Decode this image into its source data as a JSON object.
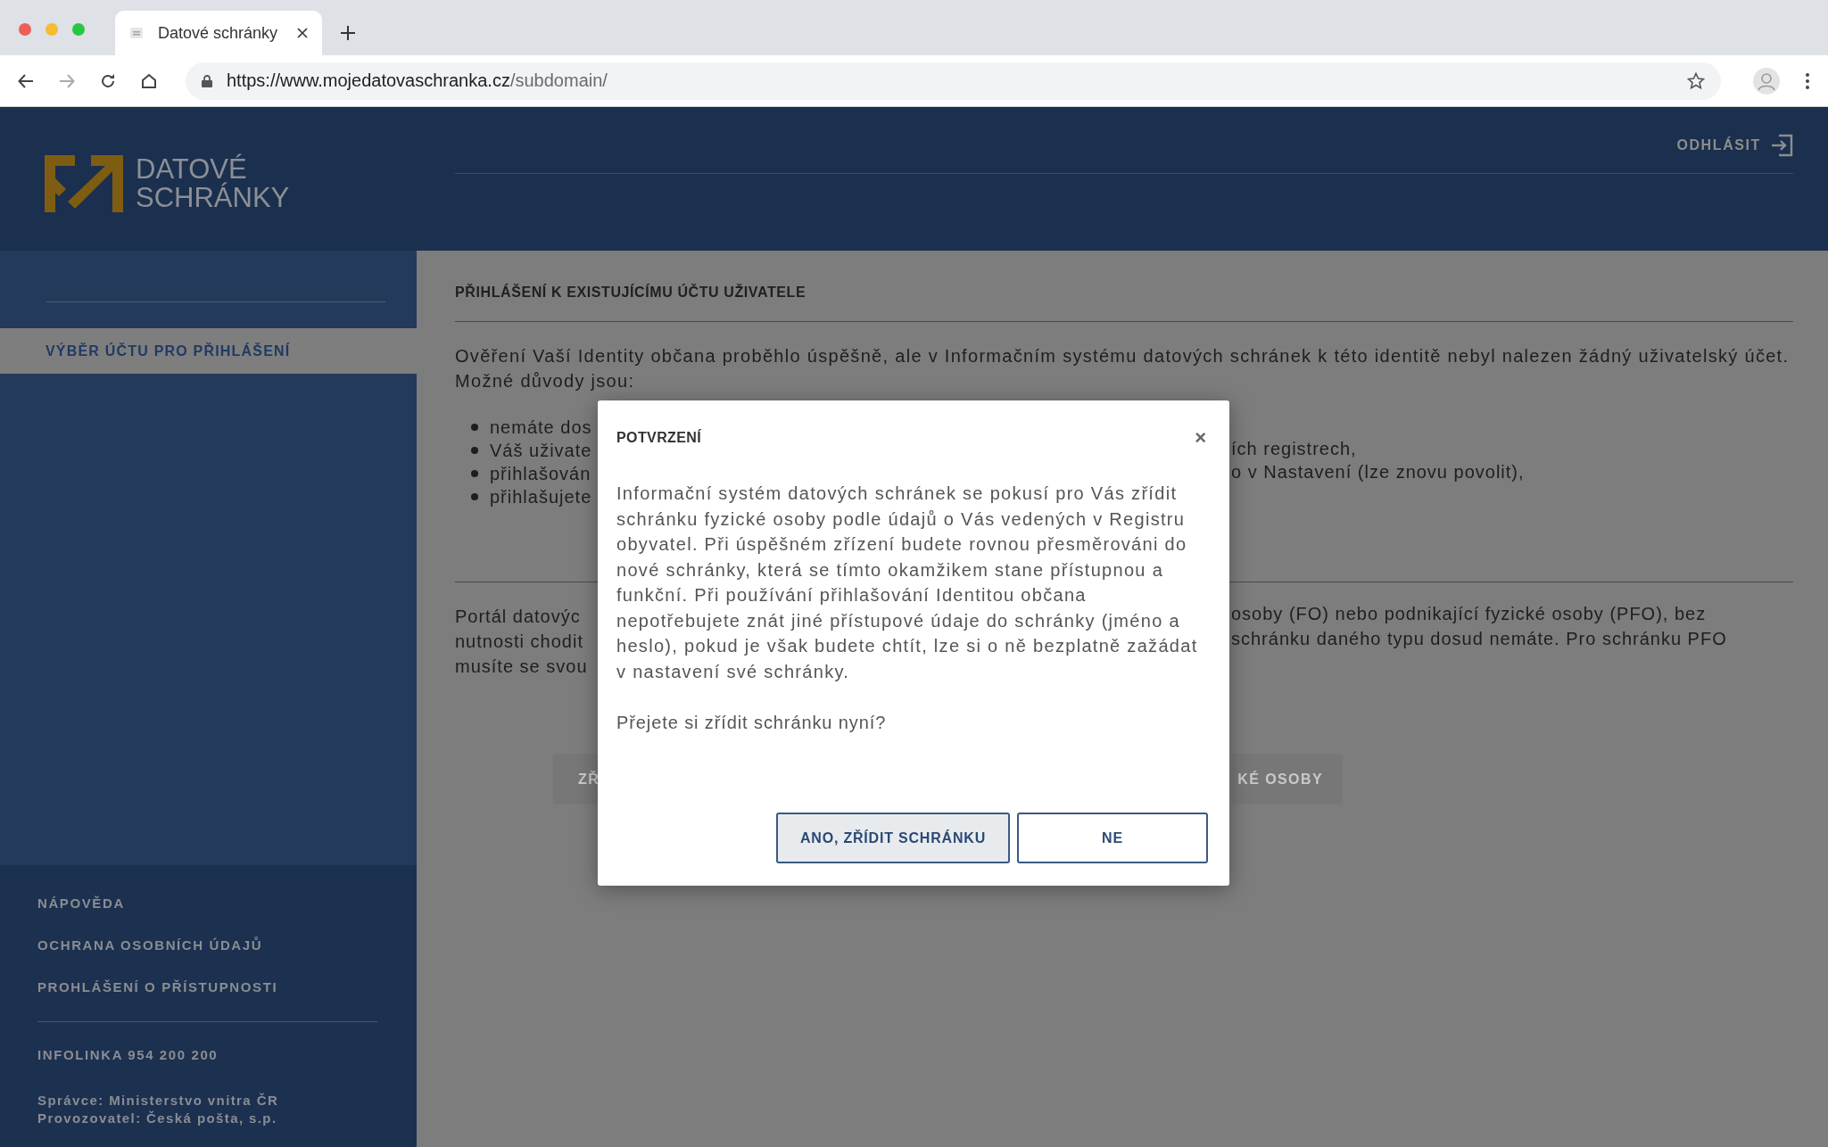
{
  "browser": {
    "tab_title": "Datové schránky",
    "url_host": "https://www.mojedatovaschranka.cz",
    "url_path": "/subdomain/"
  },
  "header": {
    "logo_lines": [
      "DATOVÉ",
      "SCHRÁNKY"
    ],
    "logout": "ODHLÁSIT"
  },
  "sidebar": {
    "items": [
      {
        "label": "VÝBĚR ÚČTU PRO PŘIHLÁŠENÍ",
        "selected": true
      }
    ],
    "footer_links": [
      "NÁPOVĚDA",
      "OCHRANA OSOBNÍCH ÚDAJŮ",
      "PROHLÁŠENÍ O PŘÍSTUPNOSTI"
    ],
    "infoline": "INFOLINKA 954 200 200",
    "operator_lines": [
      "Správce: Ministerstvo vnitra ČR",
      "Provozovatel: Česká pošta, s.p."
    ]
  },
  "main": {
    "heading": "PŘIHLÁŠENÍ K EXISTUJÍCÍMU ÚČTU UŽIVATELE",
    "intro": "Ověření Vaší Identity občana proběhlo úspěšně, ale v Informačním systému datových schránek k této identitě nebyl nalezen žádný uživatelský účet. Možné důvody jsou:",
    "reasons": [
      {
        "left": "nemáte dos"
      },
      {
        "left": "Váš uživate",
        "right": "ích registrech,"
      },
      {
        "left": "přihlašován",
        "right": "o v Nastavení (lze znovu povolit),"
      },
      {
        "left": "přihlašujete"
      }
    ],
    "portal_lines": [
      {
        "left": "Portál datovýc",
        "right": "osoby (FO) nebo podnikající fyzické osoby (PFO), bez"
      },
      {
        "left": "nutnosti chodit",
        "right": "schránku daného typu dosud nemáte. Pro schránku PFO"
      },
      {
        "left": "musíte se svou"
      }
    ],
    "partial_buttons": [
      {
        "label": "ZŘ"
      },
      {
        "label": "KÉ OSOBY"
      }
    ]
  },
  "dialog": {
    "title": "POTVRZENÍ",
    "close": "×",
    "body": "Informační systém datových schránek se pokusí pro Vás zřídit schránku fyzické osoby podle údajů o Vás vedených v Registru obyvatel. Při úspěšném zřízení budete rovnou přesměrováni do nové schránky, která se tímto okamžikem stane přístupnou a funkční. Při používání přihlašování Identitou občana nepotřebujete znát jiné přístupové údaje do schránky (jméno a heslo), pokud je však budete chtít, lze si o ně bezplatně zažádat v nastavení své schránky.",
    "question": "Přejete si zřídit schránku nyní?",
    "buttons": [
      {
        "label": "ANO, ZŘÍDIT SCHRÁNKU",
        "kind": "primary"
      },
      {
        "label": "NE",
        "kind": "secondary"
      }
    ]
  }
}
